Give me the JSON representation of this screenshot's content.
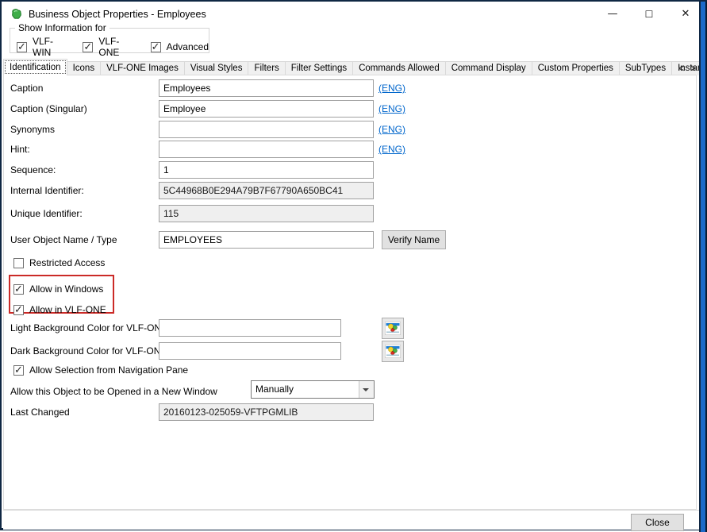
{
  "window": {
    "title": "Business Object Properties - Employees"
  },
  "icons": {
    "minimize": "—",
    "maximize": "☐",
    "close": "✕",
    "check": "✓"
  },
  "show_information": {
    "label": "Show Information for",
    "options": [
      {
        "label": "VLF-WIN",
        "checked": true
      },
      {
        "label": "VLF-ONE",
        "checked": true
      },
      {
        "label": "Advanced",
        "checked": true
      }
    ]
  },
  "tabs": {
    "selected": "Identification",
    "items": [
      "Identification",
      "Icons",
      "VLF-ONE Images",
      "Visual Styles",
      "Filters",
      "Filter Settings",
      "Commands Allowed",
      "Command Display",
      "Custom Properties",
      "SubTypes",
      "Instance List / Re"
    ],
    "scroll_left": "<",
    "scroll_right": ">"
  },
  "form": {
    "caption": {
      "label": "Caption",
      "value": "Employees",
      "lang": "(ENG)"
    },
    "caption_singular": {
      "label": "Caption (Singular)",
      "value": "Employee",
      "lang": "(ENG)"
    },
    "synonyms": {
      "label": "Synonyms",
      "value": "",
      "lang": "(ENG)"
    },
    "hint": {
      "label": "Hint:",
      "value": "",
      "lang": "(ENG)"
    },
    "sequence": {
      "label": "Sequence:",
      "value": "1"
    },
    "internal_identifier": {
      "label": "Internal Identifier:",
      "value": "5C44968B0E294A79B7F67790A650BC41",
      "readonly": true
    },
    "unique_identifier": {
      "label": "Unique Identifier:",
      "value": "115",
      "readonly": true
    },
    "user_object": {
      "label": "User Object Name / Type",
      "value": "EMPLOYEES",
      "button": "Verify Name"
    },
    "restricted_access": {
      "label": "Restricted Access",
      "checked": false
    },
    "allow_windows": {
      "label": "Allow in Windows",
      "checked": true
    },
    "allow_vlfone": {
      "label": "Allow in VLF-ONE",
      "checked": true
    },
    "light_bg": {
      "label": "Light Background Color for VLF-ONE",
      "value": ""
    },
    "dark_bg": {
      "label": "Dark Background Color for VLF-ONE",
      "value": ""
    },
    "allow_selection": {
      "label": "Allow Selection from Navigation Pane",
      "checked": true
    },
    "open_new_window": {
      "label": "Allow this Object to be Opened in a New Window",
      "value": "Manually"
    },
    "last_changed": {
      "label": "Last Changed",
      "value": "20160123-025059-VFTPGMLIB",
      "readonly": true
    }
  },
  "footer": {
    "close_label": "Close"
  },
  "colors": {
    "highlight_red": "#CB2A27",
    "link_blue": "#0066CC",
    "edge_blue": "#1B6AC9",
    "readonly_bg": "#EFEFEF"
  }
}
